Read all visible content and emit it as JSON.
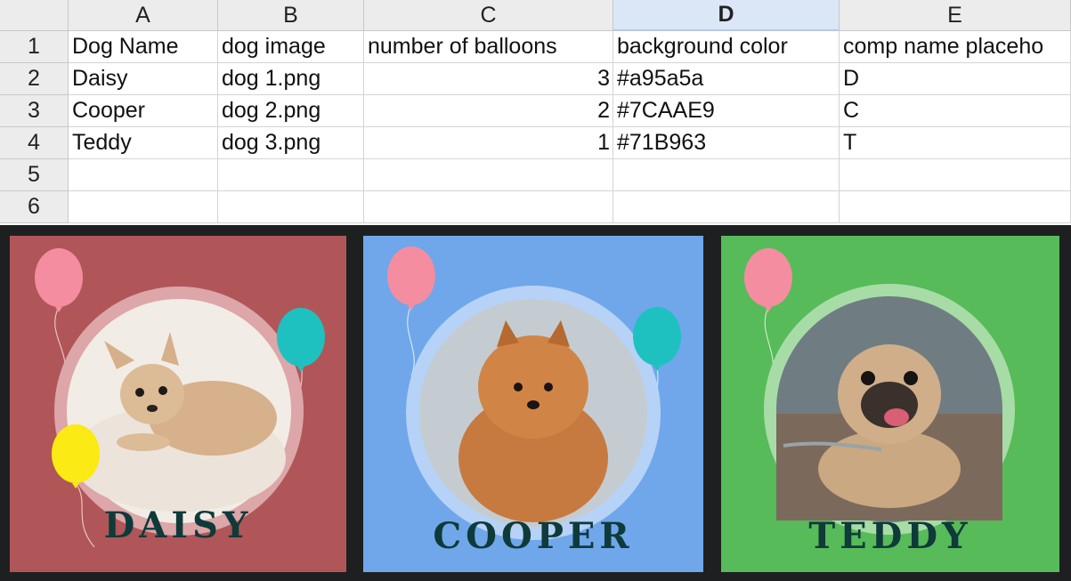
{
  "spreadsheet": {
    "column_headers": [
      "A",
      "B",
      "C",
      "D",
      "E"
    ],
    "selected_column": "D",
    "row_numbers": [
      "1",
      "2",
      "3",
      "4",
      "5",
      "6"
    ],
    "rows": [
      [
        "Dog Name",
        "dog image",
        "number of balloons",
        "background color",
        "comp name placeho"
      ],
      [
        "Daisy",
        "dog 1.png",
        "3",
        "#a95a5a",
        "D"
      ],
      [
        "Cooper",
        "dog 2.png",
        "2",
        "#7CAAE9",
        "C"
      ],
      [
        "Teddy",
        "dog 3.png",
        "1",
        "#71B963",
        "T"
      ],
      [
        "",
        "",
        "",
        "",
        ""
      ],
      [
        "",
        "",
        "",
        "",
        ""
      ]
    ]
  },
  "cards": [
    {
      "name": "DAISY",
      "image_icon": "chihuahua-photo",
      "background": "#b05658",
      "ring_color": "#dda6a8",
      "balloon_count": 3,
      "balloon_colors": [
        "#f48da0",
        "#1ec1c0",
        "#fbea13"
      ]
    },
    {
      "name": "COOPER",
      "image_icon": "pomeranian-photo",
      "background": "#6fa7ea",
      "ring_color": "#b6d2f6",
      "balloon_count": 2,
      "balloon_colors": [
        "#f48da0",
        "#1ec1c0"
      ]
    },
    {
      "name": "TEDDY",
      "image_icon": "pug-photo",
      "background": "#56bb58",
      "ring_color": "#a8dca7",
      "balloon_count": 1,
      "balloon_colors": [
        "#f48da0"
      ]
    }
  ]
}
